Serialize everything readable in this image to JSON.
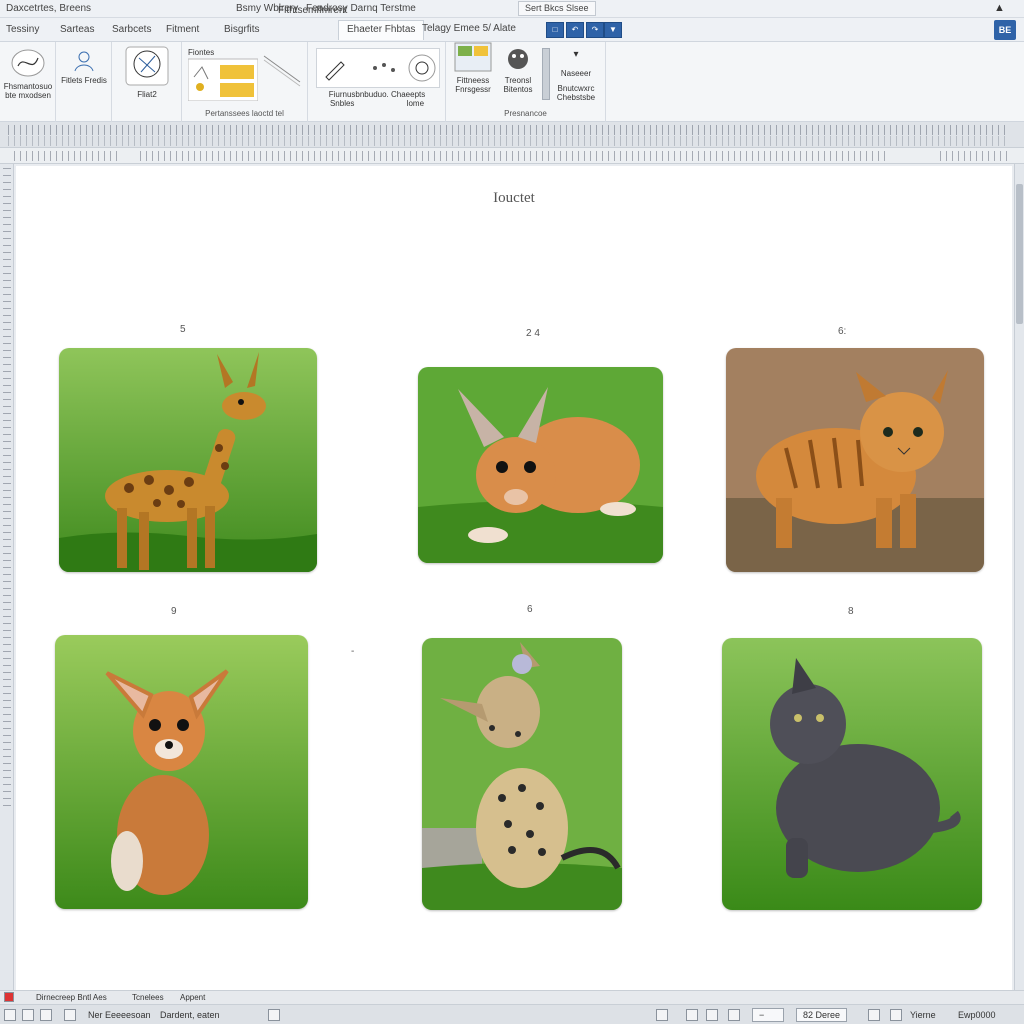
{
  "window": {
    "app_name": "Daxcetrtes, Breens",
    "title": "Bsmy Wblrery",
    "title2": "Feadrosy Darnq Terstme",
    "share_label": "Sert Bkcs Slsee",
    "account_label": "BE"
  },
  "tabs": [
    {
      "label": "Tessiny",
      "active": false
    },
    {
      "label": "Sarteas",
      "active": false
    },
    {
      "label": "Sarbcets",
      "active": false
    },
    {
      "label": "Fitment",
      "active": false
    },
    {
      "label": "Bisgrfits",
      "active": false
    },
    {
      "label": "Fithtsemffmrent",
      "active": false
    },
    {
      "label": "Ehaeter Fhbtas",
      "active": true
    }
  ],
  "tabrow_text": "Telagy Emee 5/ Alate",
  "ribbon": {
    "groups": [
      {
        "items": [
          "Fhsmantosuo",
          "bte mxodsen"
        ],
        "label": ""
      },
      {
        "items": [
          "Fitlets Fredis"
        ],
        "label": ""
      },
      {
        "items": [
          "Fliat2"
        ],
        "label": ""
      },
      {
        "items": [
          "Fiontes"
        ],
        "label": "Pertanssees laoctd tel"
      },
      {
        "items": [
          "Fiurnusbnbuduo. Chaeepts",
          "Snbles",
          "lome"
        ],
        "label": ""
      },
      {
        "items": [
          "Fittneess",
          "Fnrsgessr",
          "Treonsl",
          "Bitentos"
        ],
        "label": "Presnancoe"
      },
      {
        "items": [
          "Naseeer",
          "Bnutcwxrc",
          "Chebstsbe"
        ],
        "label": ""
      }
    ]
  },
  "document": {
    "title": "Iouctet",
    "captions": [
      "5",
      "2 4",
      "6:",
      "9",
      "6",
      "8"
    ],
    "photos": [
      {
        "name": "giraffe-deer-photo",
        "animal": "spotted deer"
      },
      {
        "name": "fox-cat-photo",
        "animal": "orange hybrid"
      },
      {
        "name": "tabby-cat-photo",
        "animal": "orange tabby"
      },
      {
        "name": "fawn-photo",
        "animal": "fawn"
      },
      {
        "name": "serval-photo",
        "animal": "spotted cat"
      },
      {
        "name": "grey-cat-photo",
        "animal": "grey cat"
      }
    ],
    "stray_mark": "-"
  },
  "statusbar": {
    "row1": [
      "Dirnecreep Bntl Aes",
      "Tcnelees",
      "Appent"
    ],
    "row2": [
      "Ner Eeeeesoan",
      "Dardent, eaten"
    ],
    "zoom_label": "82 Deree",
    "right_labels": [
      "Yierne",
      "Ewp0000"
    ]
  },
  "colors": {
    "accent": "#2f63a8",
    "ribbon_bg": "#f4f6f8",
    "page_bg": "#ffffff",
    "grass": "#4f9a2a"
  }
}
